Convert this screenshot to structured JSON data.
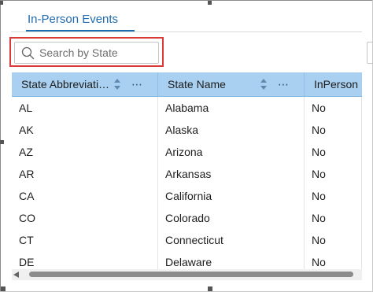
{
  "tabs": [
    {
      "label": "In-Person Events",
      "active": true
    }
  ],
  "search": {
    "placeholder": "Search by State",
    "value": ""
  },
  "table": {
    "columns": [
      {
        "label": "State Abbreviati…",
        "sortable": true,
        "menu": "⋯"
      },
      {
        "label": "State Name",
        "sortable": true,
        "menu": "⋯"
      },
      {
        "label": "InPerson"
      }
    ],
    "rows": [
      [
        "AL",
        "Alabama",
        "No"
      ],
      [
        "AK",
        "Alaska",
        "No"
      ],
      [
        "AZ",
        "Arizona",
        "No"
      ],
      [
        "AR",
        "Arkansas",
        "No"
      ],
      [
        "CA",
        "California",
        "No"
      ],
      [
        "CO",
        "Colorado",
        "No"
      ],
      [
        "CT",
        "Connecticut",
        "No"
      ],
      [
        "DE",
        "Delaware",
        "No"
      ]
    ]
  },
  "colors": {
    "accent": "#1f6bb0",
    "header_bg": "#a9d0f0",
    "highlight_border": "#d93a3a"
  },
  "icons": [
    "search-icon",
    "sort-icon",
    "more-icon",
    "scroll-left-icon"
  ]
}
